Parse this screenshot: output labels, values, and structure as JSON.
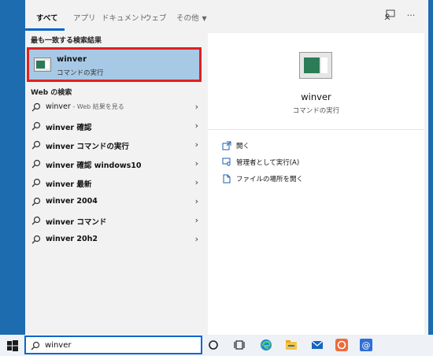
{
  "tabs": {
    "all": "すべて",
    "apps": "アプリ",
    "documents": "ドキュメント",
    "web": "ウェブ",
    "more": "その他"
  },
  "top_icons": [
    "feedback-icon",
    "more-options-icon"
  ],
  "left": {
    "best_match_header": "最も一致する検索結果",
    "best_match": {
      "title": "winver",
      "subtitle": "コマンドの実行"
    },
    "web_header": "Web の検索",
    "web_results": [
      {
        "bold": "winver",
        "suffix": " - Web 結果を見る"
      },
      {
        "bold": "winver 確認",
        "suffix": ""
      },
      {
        "bold": "winver コマンドの実行",
        "suffix": ""
      },
      {
        "bold": "winver 確認 windows10",
        "suffix": ""
      },
      {
        "bold": "winver 最新",
        "suffix": ""
      },
      {
        "bold": "winver 2004",
        "suffix": ""
      },
      {
        "bold": "winver コマンド",
        "suffix": ""
      },
      {
        "bold": "winver 20h2",
        "suffix": ""
      }
    ]
  },
  "preview": {
    "title": "winver",
    "subtitle": "コマンドの実行",
    "actions": [
      {
        "label": "開く",
        "icon": "open-icon"
      },
      {
        "label": "管理者として実行(A)",
        "icon": "shield-run-icon"
      },
      {
        "label": "ファイルの場所を開く",
        "icon": "file-location-icon"
      }
    ]
  },
  "taskbar": {
    "search_value": "winver",
    "icons": [
      "windows-start-icon",
      "cortana-icon",
      "task-view-icon",
      "edge-icon",
      "file-explorer-icon",
      "mail-icon",
      "app-orange-icon",
      "app-blue-at-icon"
    ]
  },
  "colors": {
    "accent": "#0b66d0",
    "highlight": "#a8c9e6",
    "selection_border": "#e02020"
  }
}
